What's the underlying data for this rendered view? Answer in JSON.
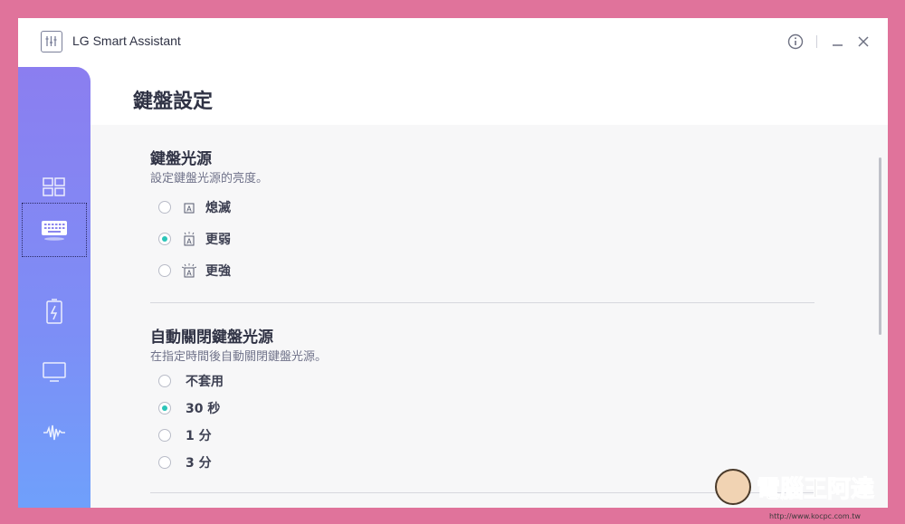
{
  "app": {
    "title": "LG Smart Assistant"
  },
  "titlebar": {
    "info_icon": "info-icon",
    "minimize_icon": "minimize-icon",
    "close_icon": "close-icon"
  },
  "sidebar": {
    "items": [
      {
        "name": "dashboard-icon",
        "active": false
      },
      {
        "name": "keyboard-icon",
        "active": true
      },
      {
        "name": "battery-icon",
        "active": false
      },
      {
        "name": "monitor-icon",
        "active": false
      },
      {
        "name": "sound-icon",
        "active": false
      }
    ]
  },
  "page": {
    "title": "鍵盤設定"
  },
  "backlight": {
    "title": "鍵盤光源",
    "description": "設定鍵盤光源的亮度。",
    "options": [
      {
        "label": "熄滅",
        "icon": "backlight-off-icon",
        "checked": false
      },
      {
        "label": "更弱",
        "icon": "backlight-low-icon",
        "checked": true
      },
      {
        "label": "更強",
        "icon": "backlight-high-icon",
        "checked": false
      }
    ]
  },
  "auto_off": {
    "title": "自動關閉鍵盤光源",
    "description": "在指定時間後自動關閉鍵盤光源。",
    "options": [
      {
        "label": "不套用",
        "checked": false
      },
      {
        "label": "30 秒",
        "checked": true
      },
      {
        "label": "1 分",
        "checked": false
      },
      {
        "label": "3 分",
        "checked": false
      }
    ]
  },
  "watermark": {
    "text": "電腦王阿達",
    "url": "http://www.kocpc.com.tw"
  },
  "colors": {
    "accent": "#2cc5b9",
    "sidebar_top": "#8b7ef0",
    "sidebar_bottom": "#6fa0fb",
    "frame": "#e0739b"
  }
}
